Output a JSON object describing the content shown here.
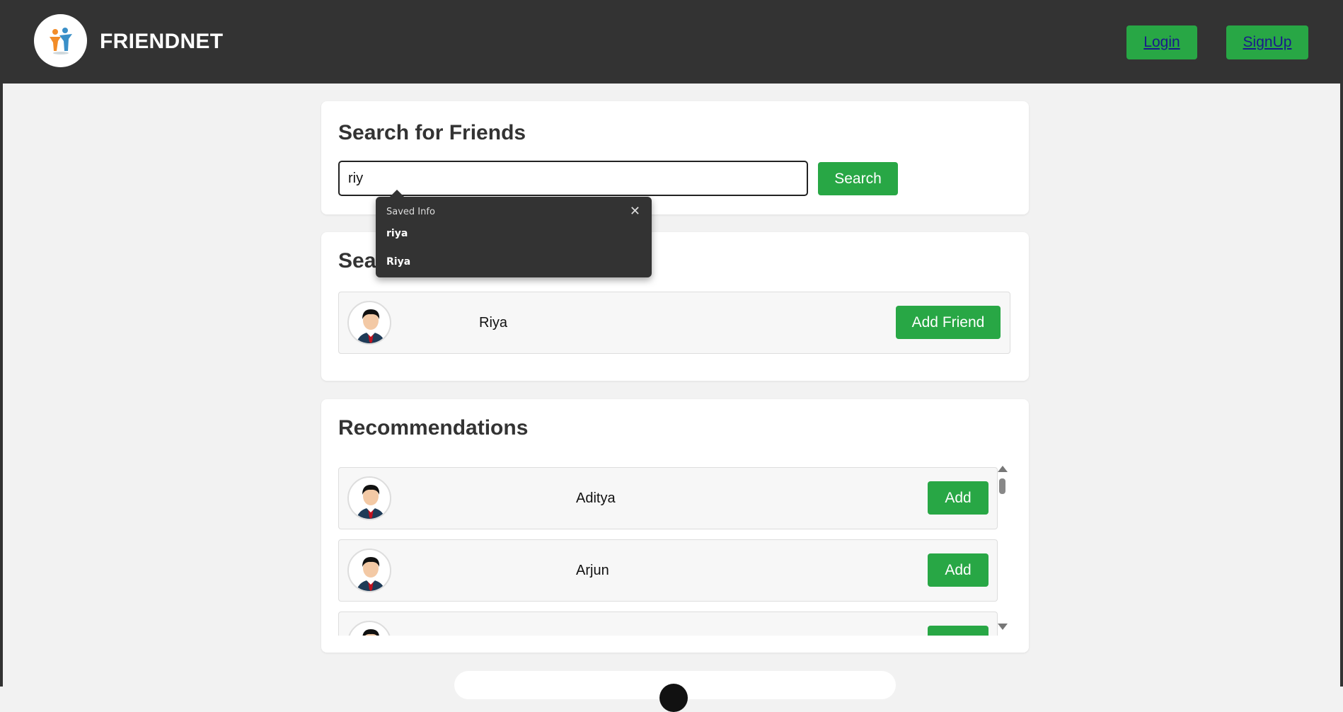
{
  "header": {
    "brand": "FRIENDNET",
    "login_label": "Login",
    "signup_label": "SignUp"
  },
  "search": {
    "title": "Search for Friends",
    "input_value": "riy",
    "button_label": "Search"
  },
  "autofill": {
    "title": "Saved Info",
    "items": [
      "riya",
      "Riya"
    ]
  },
  "results": {
    "title": "Search Results",
    "items": [
      {
        "name": "Riya",
        "action": "Add Friend"
      }
    ]
  },
  "recommendations": {
    "title": "Recommendations",
    "items": [
      {
        "name": "Aditya",
        "action": "Add"
      },
      {
        "name": "Arjun",
        "action": "Add"
      },
      {
        "name": "",
        "action": ""
      }
    ]
  }
}
